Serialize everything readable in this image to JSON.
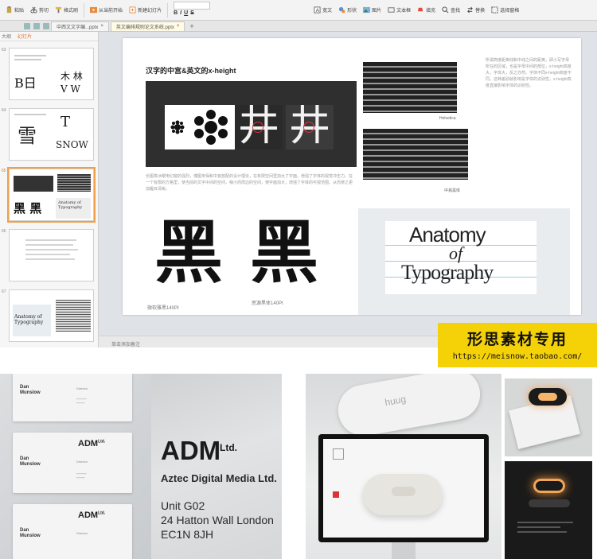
{
  "toolbar": {
    "cut": "剪切",
    "paste": "粘贴",
    "format_painter": "格式刷",
    "from_current": "从当前开始",
    "new_slide": "新建幻灯片",
    "format_bold": "B",
    "format_italic": "I",
    "format_underline": "U",
    "format_strike": "S",
    "shape": "形状",
    "picture": "图片",
    "textbox_label": "文本框",
    "fill": "填充",
    "find": "查找",
    "replace": "替换",
    "arrange": "排列",
    "select_window": "选择窗格",
    "text_box": "宽文"
  },
  "tabs": [
    {
      "label": "中西文文字编...pptx",
      "active": false
    },
    {
      "label": "英文编排规则论文系统.pptx",
      "active": true
    }
  ],
  "panel": {
    "tab_outline": "大纲",
    "tab_slides": "幻灯片",
    "slides": [
      {
        "num": "63",
        "top_text": "B日",
        "top_text2": "木 林",
        "bottom_text": "V W"
      },
      {
        "num": "64",
        "top_text": "雪",
        "top_text2": "T",
        "bottom_text": "SNOW"
      },
      {
        "num": "65",
        "top_text": "黑 黑",
        "bottom_text": "Anatomy of Typography"
      },
      {
        "num": "66"
      },
      {
        "num": "67",
        "bottom_text": "Anatomy of Typography"
      }
    ]
  },
  "slide": {
    "title": "汉字的中宫&英文的x-height",
    "glyph_left": "井",
    "glyph_right": "井",
    "caption_mid": "Helvetica",
    "caption_mid2": "中易黑体",
    "body": "长图埃冰眼电幻窗的强烈，博图宋保和中宫放配的设计理论，在有限空间里加大了字面。增强了字体的视觉冲击力。在一个有限的方格里，使当前的文字中间的空间，稍小而周边的空间，使字面加大，增强了字体的可视范围。从而使之更加醒目清晰。",
    "right_text": "所谓高度距离线和中线之间的距离，即小写字母所在的区域，也是字母中间的部位，x-height高度大，字体大，反之亦然。字体不同x-height高度不同，这种差别就影响是字体的识别性，x-height高度直接影响字体的识别性。",
    "hei_left": "黑",
    "hei_right": "黑",
    "cap_left": "微软雅黑140Pt",
    "cap_right": "思源黑体140Pt",
    "anatomy_1": "Anatomy",
    "anatomy_2": "of",
    "anatomy_3": "Typography"
  },
  "notes": "单击添加备注",
  "watermark": {
    "title": "形思素材专用",
    "url": "https://meisnow.taobao.com/"
  },
  "photos": {
    "card_name": "Dan\nMunslow",
    "card_role": "Director",
    "card_logo": "ADM",
    "adm_ltd": "Ltd.",
    "adm_big": "ADM",
    "adm_full": "Aztec Digital Media Ltd.",
    "addr_1": "Unit G02",
    "addr_2": "24 Hatton Wall London",
    "addr_3": "EC1N 8JH",
    "brand_small": "huug"
  },
  "colors": {
    "selected_outline": "#f0a04a",
    "watermark_bg": "#f5d108",
    "dark_panel": "#2f2f2f"
  }
}
